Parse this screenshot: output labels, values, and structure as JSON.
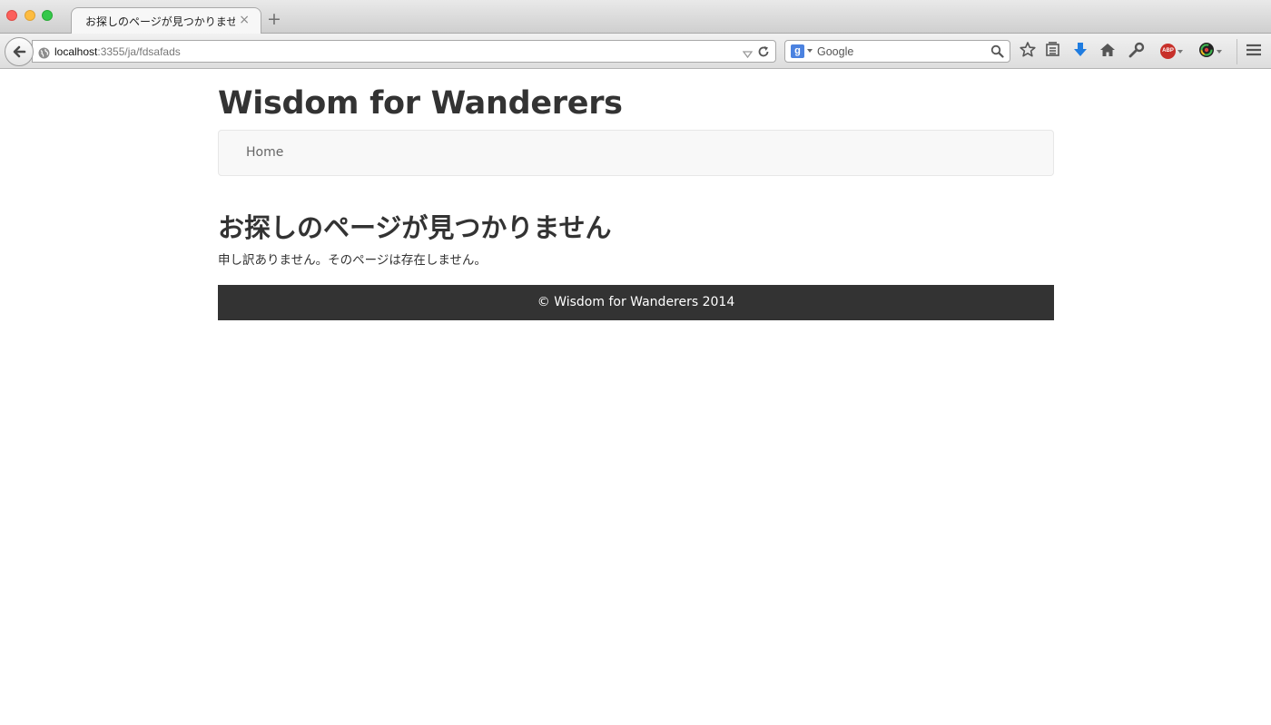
{
  "browser": {
    "tab": {
      "title": "お探しのページが見つかりませ...",
      "close_glyph": "×"
    },
    "new_tab_glyph": "+",
    "url": {
      "host": "localhost",
      "path": ":3355/ja/fdsafads"
    },
    "search": {
      "placeholder": "Google",
      "engine_letter": "g"
    },
    "adblock_label": "ABP"
  },
  "site": {
    "title": "Wisdom for Wanderers",
    "nav": {
      "home_label": "Home"
    },
    "error": {
      "heading": "お探しのページが見つかりません",
      "message": "申し訳ありません。そのページは存在しません。"
    },
    "footer": {
      "text": "© Wisdom for Wanderers 2014"
    }
  },
  "colors": {
    "footer_bg": "#333333",
    "nav_bg": "#f8f8f8",
    "download_arrow": "#1f7ce0",
    "adblock": "#c7302a"
  }
}
